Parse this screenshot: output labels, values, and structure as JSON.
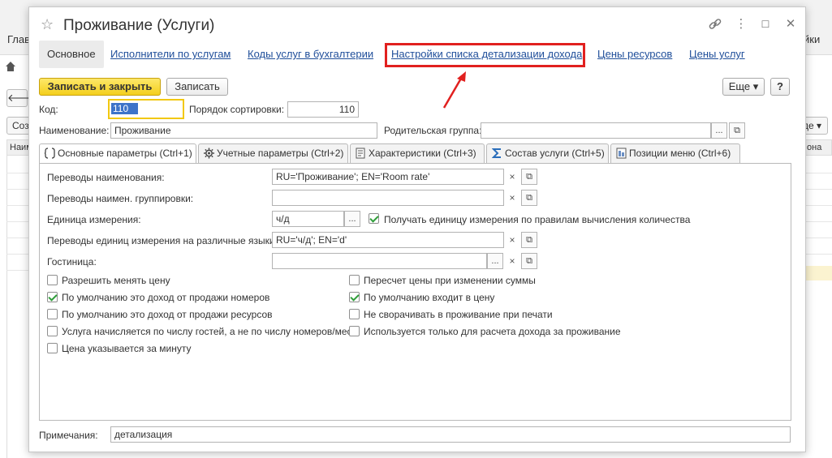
{
  "background": {
    "left_label": "Глав",
    "right_label": "йки",
    "create_button": "Соз",
    "more_button": "де ▾",
    "col_left": "Наим",
    "col_right": "она"
  },
  "dialog": {
    "title": "Проживание (Услуги)"
  },
  "nav": {
    "items": [
      {
        "label": "Основное"
      },
      {
        "label": "Исполнители по услугам"
      },
      {
        "label": "Коды услуг в бухгалтерии"
      },
      {
        "label": "Настройки списка детализации дохода"
      },
      {
        "label": "Цены ресурсов"
      },
      {
        "label": "Цены услуг"
      }
    ]
  },
  "toolbar": {
    "save_close": "Записать и закрыть",
    "save": "Записать",
    "more": "Еще ▾",
    "help": "?"
  },
  "form": {
    "code_label": "Код:",
    "code_value": "110",
    "sort_label": "Порядок сортировки:",
    "sort_value": "110",
    "name_label": "Наименование:",
    "name_value": "Проживание",
    "parent_label": "Родительская группа:",
    "parent_value": ""
  },
  "tabs": [
    {
      "label": "Основные параметры (Ctrl+1)",
      "icon": "brackets-icon"
    },
    {
      "label": "Учетные параметры (Ctrl+2)",
      "icon": "gear-icon"
    },
    {
      "label": "Характеристики (Ctrl+3)",
      "icon": "document-icon"
    },
    {
      "label": "Состав услуги (Ctrl+5)",
      "icon": "sigma-icon"
    },
    {
      "label": "Позиции меню (Ctrl+6)",
      "icon": "menu-icon"
    }
  ],
  "params": {
    "name_trans_label": "Переводы наименования:",
    "name_trans_value": "RU='Проживание'; EN='Room rate'",
    "group_trans_label": "Переводы наимен. группировки:",
    "group_trans_value": "",
    "unit_label": "Единица измерения:",
    "unit_value": "ч/д",
    "unit_rule_label": "Получать единицу измерения по правилам вычисления количества",
    "unit_trans_label": "Переводы единиц измерения на различные языки:",
    "unit_trans_value": "RU='ч/д'; EN='d'",
    "hotel_label": "Гостиница:",
    "hotel_value": ""
  },
  "checkboxes_left": [
    {
      "label": "Разрешить менять цену",
      "checked": false
    },
    {
      "label": "По умолчанию это доход от продажи номеров",
      "checked": true
    },
    {
      "label": "По умолчанию это доход от продажи ресурсов",
      "checked": false
    },
    {
      "label": "Услуга начисляется по числу гостей, а не по числу номеров/мест",
      "checked": false
    },
    {
      "label": "Цена указывается за минуту",
      "checked": false
    }
  ],
  "checkboxes_right": [
    {
      "label": "Пересчет цены при изменении суммы",
      "checked": false
    },
    {
      "label": "По умолчанию входит в цену",
      "checked": true
    },
    {
      "label": "Не сворачивать в проживание при печати",
      "checked": false
    },
    {
      "label": "Используется только для расчета дохода за проживание",
      "checked": false
    }
  ],
  "notes": {
    "label": "Примечания:",
    "value": "детализация"
  },
  "colors": {
    "highlight_frame": "#e1201f",
    "primary_button": "#f4cf1c",
    "link": "#1f4e9a"
  }
}
